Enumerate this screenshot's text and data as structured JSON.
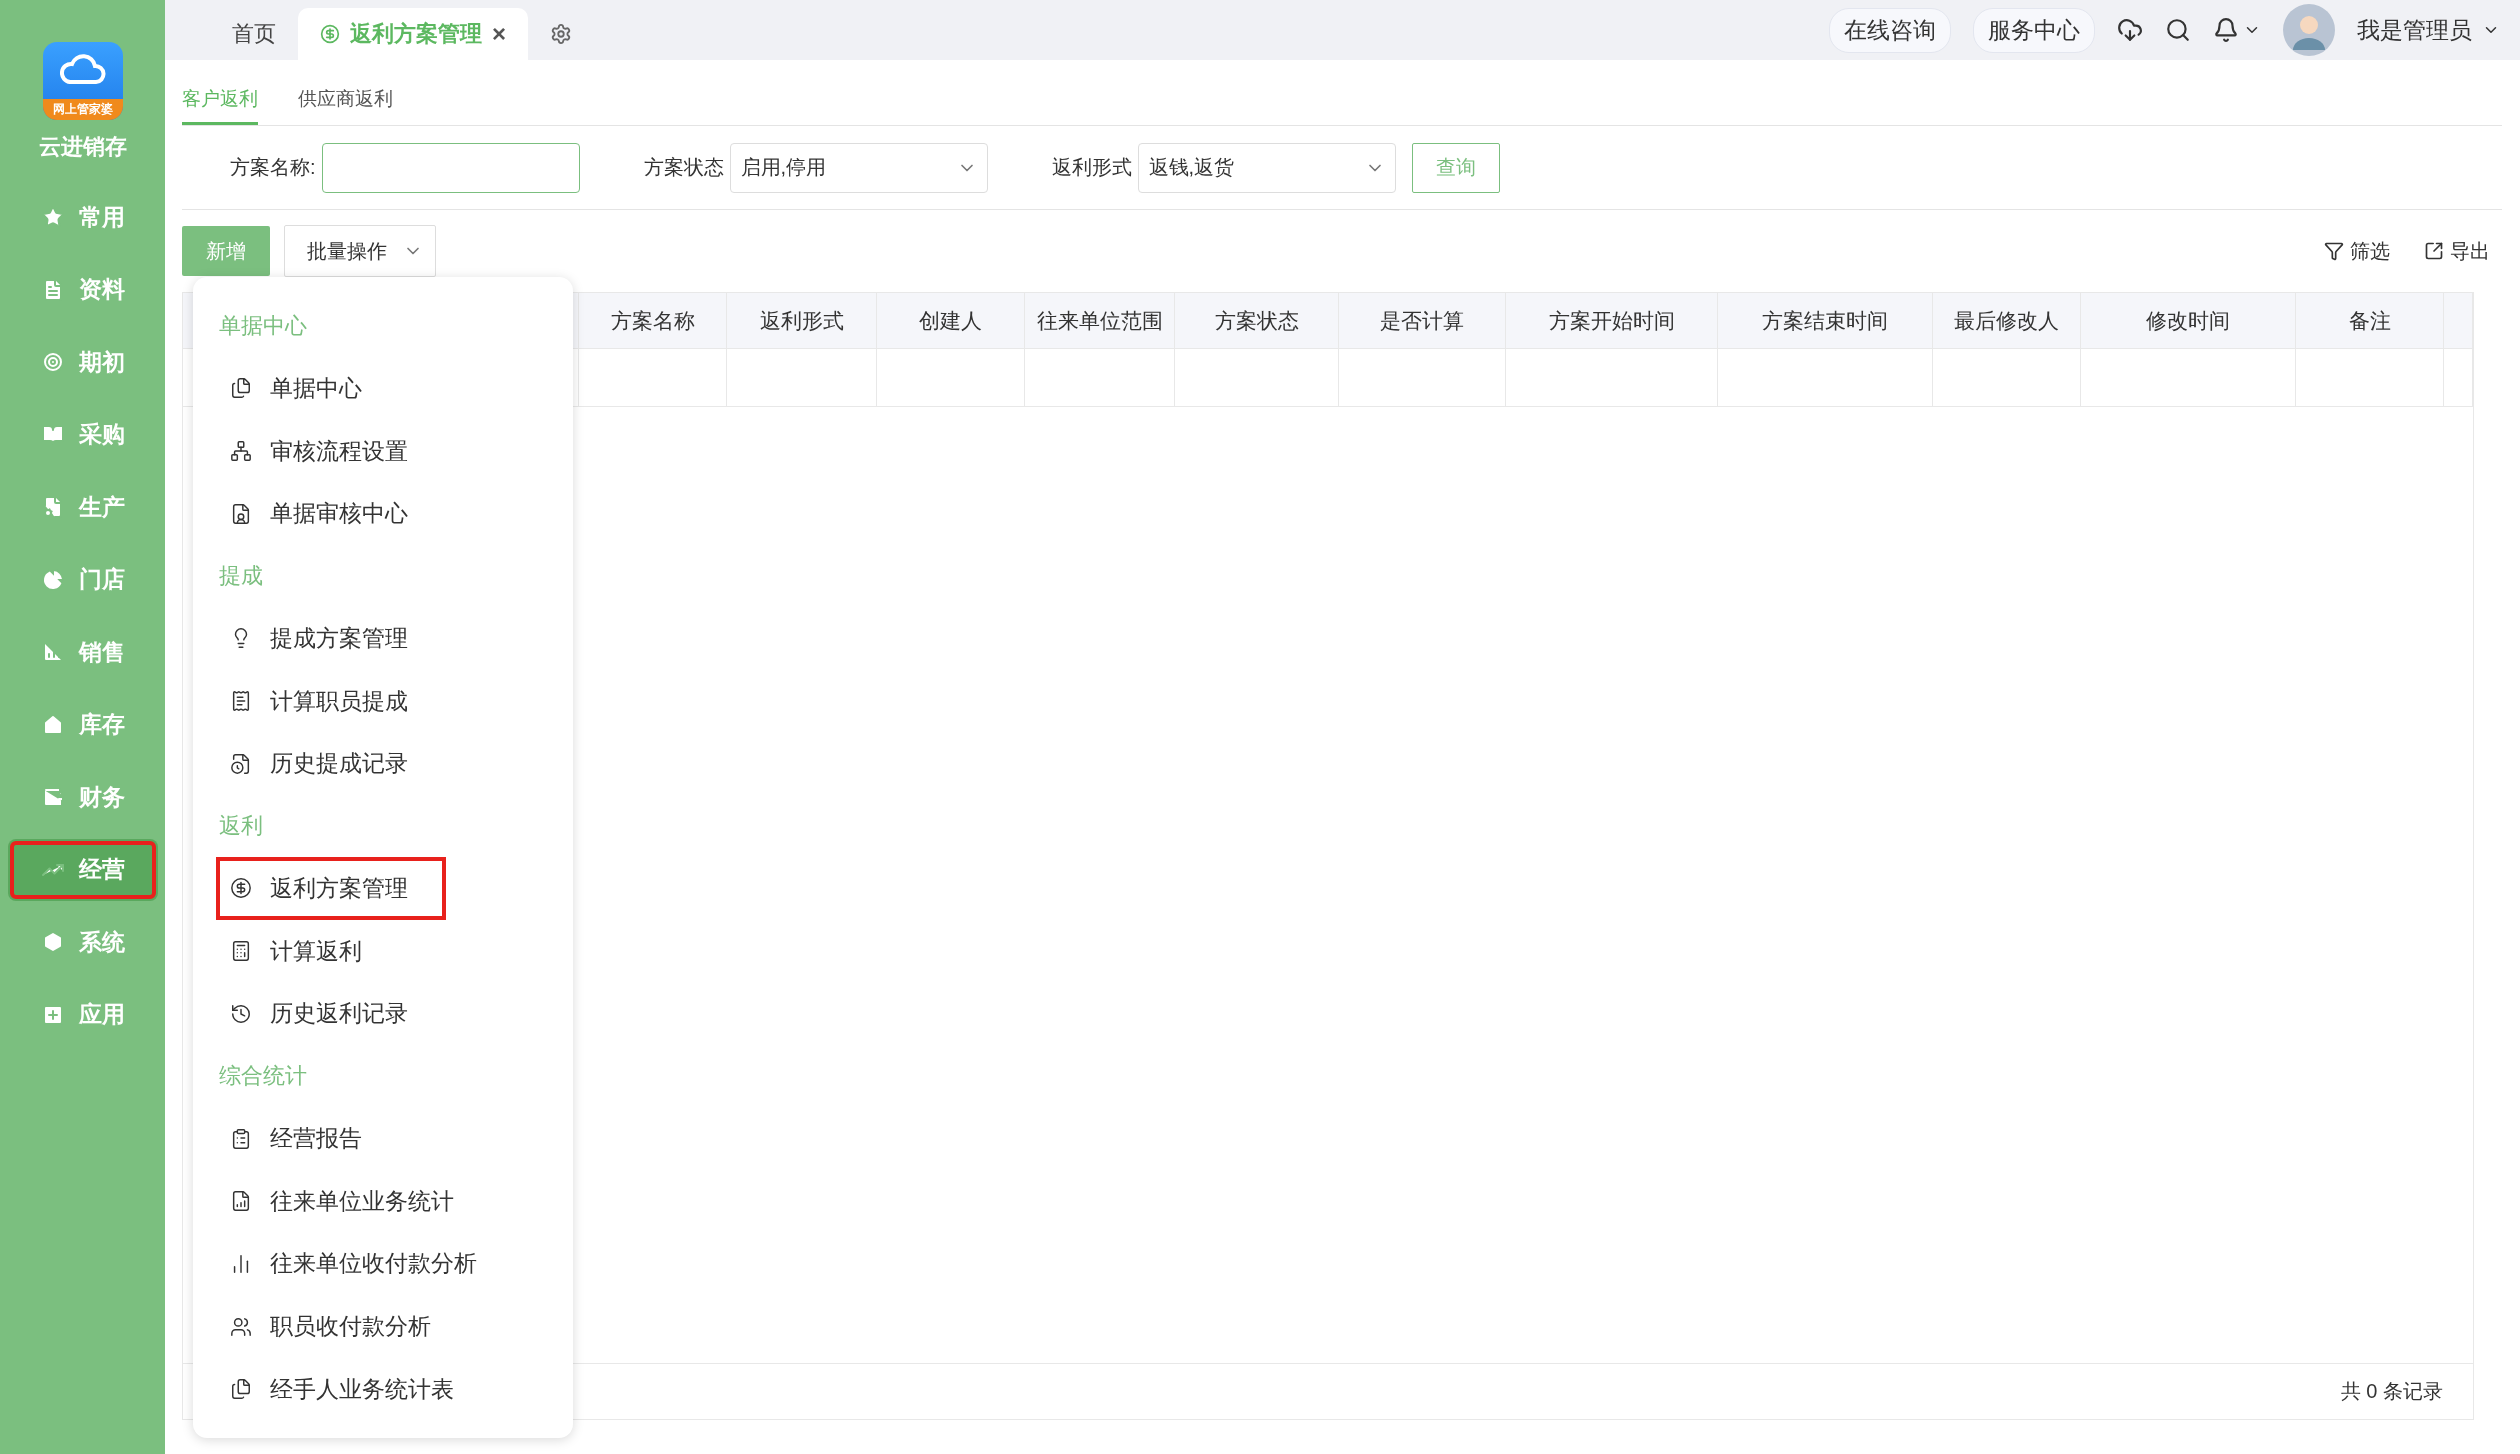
{
  "sidebar": {
    "logo_badge": "网上管家婆",
    "app_name": "云进销存",
    "items": [
      {
        "label": "常用",
        "selected": false,
        "highlighted": false
      },
      {
        "label": "资料",
        "selected": false,
        "highlighted": false
      },
      {
        "label": "期初",
        "selected": false,
        "highlighted": false
      },
      {
        "label": "采购",
        "selected": false,
        "highlighted": false
      },
      {
        "label": "生产",
        "selected": false,
        "highlighted": false
      },
      {
        "label": "门店",
        "selected": false,
        "highlighted": false
      },
      {
        "label": "销售",
        "selected": false,
        "highlighted": false
      },
      {
        "label": "库存",
        "selected": false,
        "highlighted": false
      },
      {
        "label": "财务",
        "selected": false,
        "highlighted": false
      },
      {
        "label": "经营",
        "selected": true,
        "highlighted": true
      },
      {
        "label": "系统",
        "selected": false,
        "highlighted": false
      },
      {
        "label": "应用",
        "selected": false,
        "highlighted": false
      }
    ]
  },
  "tabs": [
    {
      "label": "首页",
      "selected": false
    },
    {
      "label": "返利方案管理",
      "selected": true,
      "close": "×"
    }
  ],
  "header_links": [
    "在线咨询",
    "服务中心"
  ],
  "user": {
    "name": "我是管理员"
  },
  "sub_tabs": [
    {
      "label": "客户返利",
      "selected": true
    },
    {
      "label": "供应商返利",
      "selected": false
    }
  ],
  "filters": [
    {
      "kind": "input",
      "label": "方案名称:"
    },
    {
      "kind": "select",
      "label": "方案状态",
      "value": "启用,停用"
    },
    {
      "kind": "select",
      "label": "返利形式",
      "value": "返钱,返货"
    }
  ],
  "query_button": "查询",
  "toolbar": {
    "add": "新增",
    "batch": "批量操作",
    "tools": [
      "筛选",
      "导出"
    ]
  },
  "table": {
    "columns": [
      "方案名称",
      "返利形式",
      "创建人",
      "往来单位范围",
      "方案状态",
      "是否计算",
      "方案开始时间",
      "方案结束时间",
      "最后修改人",
      "修改时间",
      "备注"
    ]
  },
  "footer": "共 0 条记录",
  "menu": [
    {
      "title": "单据中心",
      "items": [
        {
          "label": "单据中心",
          "highlighted": false
        },
        {
          "label": "审核流程设置",
          "highlighted": false
        },
        {
          "label": "单据审核中心",
          "highlighted": false
        }
      ]
    },
    {
      "title": "提成",
      "items": [
        {
          "label": "提成方案管理",
          "highlighted": false
        },
        {
          "label": "计算职员提成",
          "highlighted": false
        },
        {
          "label": "历史提成记录",
          "highlighted": false
        }
      ]
    },
    {
      "title": "返利",
      "items": [
        {
          "label": "返利方案管理",
          "highlighted": true
        },
        {
          "label": "计算返利",
          "highlighted": false
        },
        {
          "label": "历史返利记录",
          "highlighted": false
        }
      ]
    },
    {
      "title": "综合统计",
      "items": [
        {
          "label": "经营报告",
          "highlighted": false
        },
        {
          "label": "往来单位业务统计",
          "highlighted": false
        },
        {
          "label": "往来单位收付款分析",
          "highlighted": false
        },
        {
          "label": "职员收付款分析",
          "highlighted": false
        },
        {
          "label": "经手人业务统计表",
          "highlighted": false
        }
      ]
    }
  ]
}
